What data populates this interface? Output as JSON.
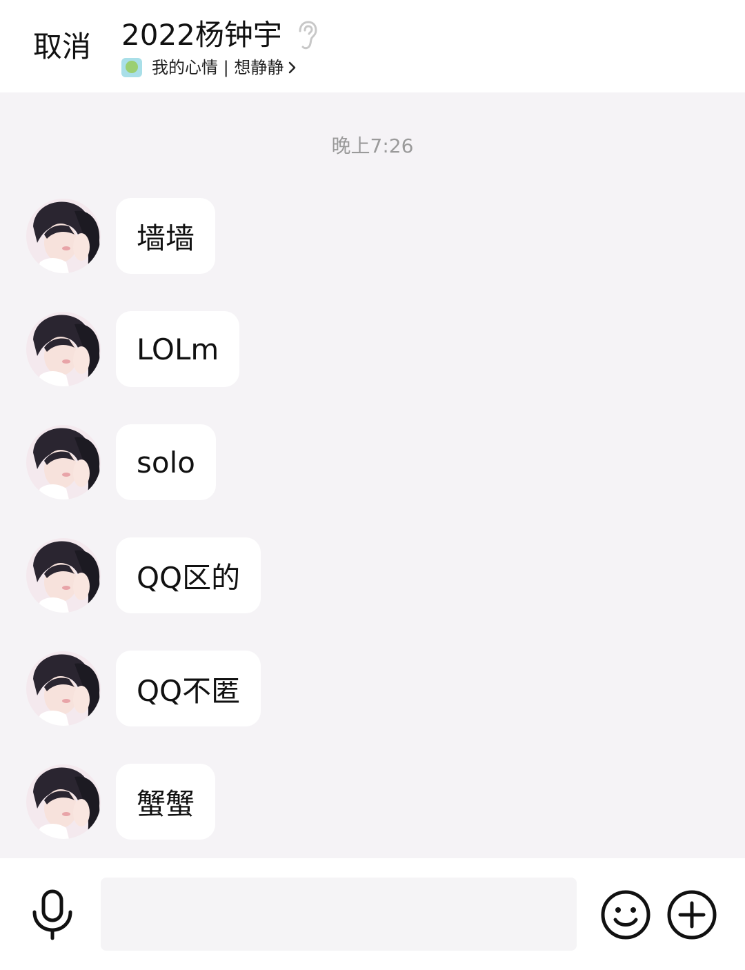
{
  "header": {
    "cancel_label": "取消",
    "title": "2022杨钟宇",
    "status": "我的心情 | 想静静"
  },
  "chat": {
    "timestamp": "晚上7:26",
    "messages": [
      {
        "text": "墙墙"
      },
      {
        "text": "LOLm"
      },
      {
        "text": "solo"
      },
      {
        "text": "QQ区的"
      },
      {
        "text": "QQ不匿"
      },
      {
        "text": "蟹蟹"
      }
    ]
  },
  "input": {
    "value": "",
    "placeholder": ""
  },
  "icons": {
    "ear": "ear-icon",
    "mood": "mood-status-icon",
    "chevron": "chevron-right-icon",
    "mic": "microphone-icon",
    "emoji": "smiley-icon",
    "plus": "plus-icon"
  },
  "colors": {
    "chat_background": "#f5f3f6",
    "bubble": "#ffffff",
    "timestamp_text": "#9a9a9a"
  }
}
